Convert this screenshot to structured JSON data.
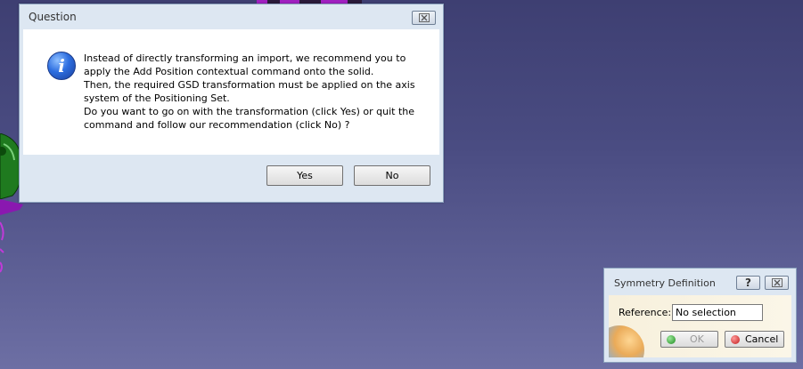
{
  "question_dialog": {
    "title": "Question",
    "close_icon": "close-icon",
    "icon": "info-icon",
    "icon_glyph": "i",
    "message": "Instead of directly transforming an import, we recommend you to\napply the Add Position contextual command onto the solid.\nThen, the required GSD transformation must be applied on the axis\nsystem of the Positioning Set.\nDo you want to go on with the transformation (click Yes) or quit the\ncommand and follow our recommendation (click No) ?",
    "yes_label": "Yes",
    "no_label": "No"
  },
  "symmetry_dialog": {
    "title": "Symmetry Definition",
    "help_glyph": "?",
    "close_glyph": "☒",
    "reference_label": "Reference:",
    "reference_value": "No selection",
    "ok_label": "OK",
    "cancel_label": "Cancel"
  },
  "colors": {
    "background": "#4a4c82",
    "dialog_frame": "#dde7f2",
    "model_purple": "#a020c0",
    "model_green": "#1c8a1c"
  }
}
